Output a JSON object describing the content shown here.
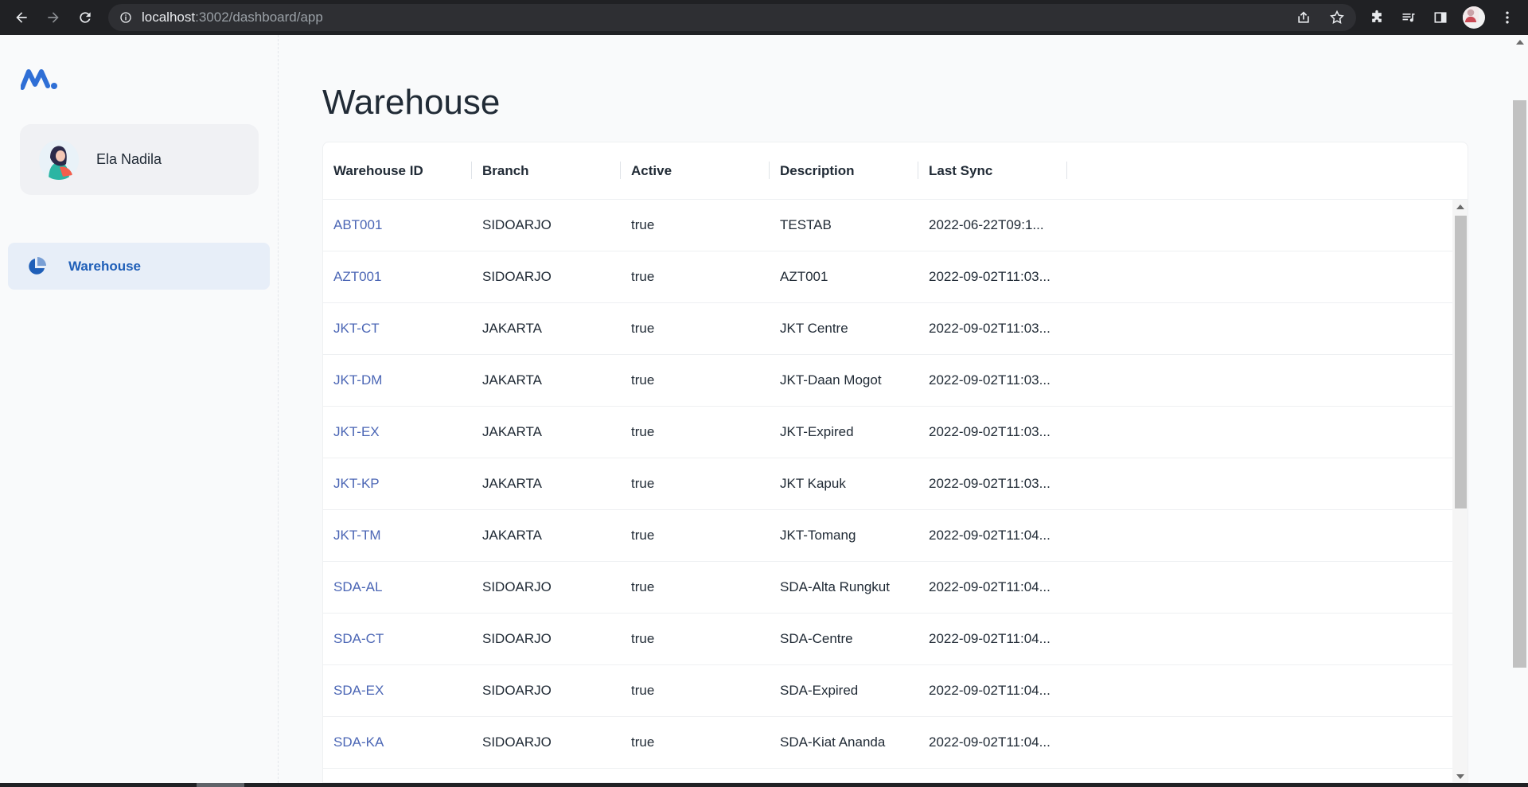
{
  "browser": {
    "url_host": "localhost",
    "url_rest": ":3002/dashboard/app"
  },
  "colors": {
    "accent": "#1f5fb8",
    "link": "#4b66b5",
    "nav_active_bg": "#e7eef8"
  },
  "sidebar": {
    "account_name": "Ela Nadila",
    "nav_items": [
      {
        "label": "Warehouse",
        "icon": "pie-chart-icon",
        "active": true
      }
    ]
  },
  "main": {
    "title": "Warehouse",
    "columns": [
      "Warehouse ID",
      "Branch",
      "Active",
      "Description",
      "Last Sync"
    ],
    "rows": [
      [
        "ABT001",
        "SIDOARJO",
        "true",
        "TESTAB",
        "2022-06-22T09:1..."
      ],
      [
        "AZT001",
        "SIDOARJO",
        "true",
        "AZT001",
        "2022-09-02T11:03..."
      ],
      [
        "JKT-CT",
        "JAKARTA",
        "true",
        "JKT Centre",
        "2022-09-02T11:03..."
      ],
      [
        "JKT-DM",
        "JAKARTA",
        "true",
        "JKT-Daan Mogot",
        "2022-09-02T11:03..."
      ],
      [
        "JKT-EX",
        "JAKARTA",
        "true",
        "JKT-Expired",
        "2022-09-02T11:03..."
      ],
      [
        "JKT-KP",
        "JAKARTA",
        "true",
        "JKT Kapuk",
        "2022-09-02T11:03..."
      ],
      [
        "JKT-TM",
        "JAKARTA",
        "true",
        "JKT-Tomang",
        "2022-09-02T11:04..."
      ],
      [
        "SDA-AL",
        "SIDOARJO",
        "true",
        "SDA-Alta Rungkut",
        "2022-09-02T11:04..."
      ],
      [
        "SDA-CT",
        "SIDOARJO",
        "true",
        "SDA-Centre",
        "2022-09-02T11:04..."
      ],
      [
        "SDA-EX",
        "SIDOARJO",
        "true",
        "SDA-Expired",
        "2022-09-02T11:04..."
      ],
      [
        "SDA-KA",
        "SIDOARJO",
        "true",
        "SDA-Kiat Ananda",
        "2022-09-02T11:04..."
      ]
    ]
  }
}
